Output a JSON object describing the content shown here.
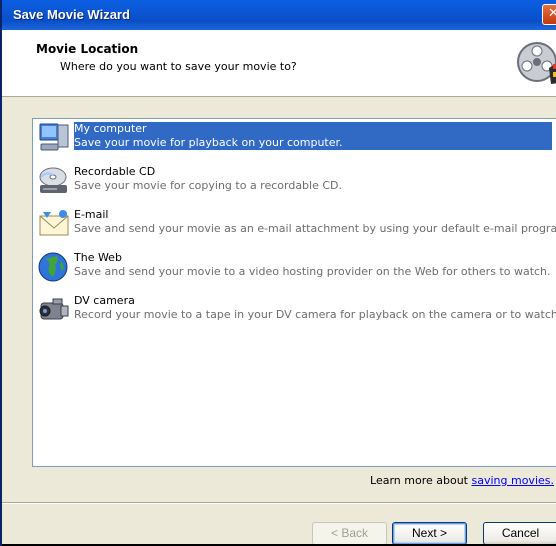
{
  "window": {
    "title": "Save Movie Wizard"
  },
  "header": {
    "title": "Movie Location",
    "subtitle": "Where do you want to save your movie to?",
    "icon": "film-reel-icon"
  },
  "options": [
    {
      "label": "My computer",
      "description": "Save your movie for playback on your computer.",
      "icon": "computer-icon",
      "selected": true
    },
    {
      "label": "Recordable CD",
      "description": "Save your movie for copying to a recordable CD.",
      "icon": "cd-drive-icon",
      "selected": false
    },
    {
      "label": "E-mail",
      "description": "Save and send your movie as an e-mail attachment by using your default e-mail program.",
      "icon": "envelope-icon",
      "selected": false
    },
    {
      "label": "The Web",
      "description": "Save and send your movie to a video hosting provider on the Web for others to watch.",
      "icon": "globe-icon",
      "selected": false
    },
    {
      "label": "DV camera",
      "description": "Record your movie to a tape in your DV camera for playback on the camera or to watch o...",
      "icon": "camcorder-icon",
      "selected": false
    }
  ],
  "learn_more": {
    "prefix": "Learn more about ",
    "link": "saving movies."
  },
  "buttons": {
    "back": "< Back",
    "next": "Next >",
    "cancel": "Cancel"
  },
  "colors": {
    "titlebar": "#0a5fe0",
    "selection": "#316ac5",
    "dialog_bg": "#ece9d8"
  }
}
